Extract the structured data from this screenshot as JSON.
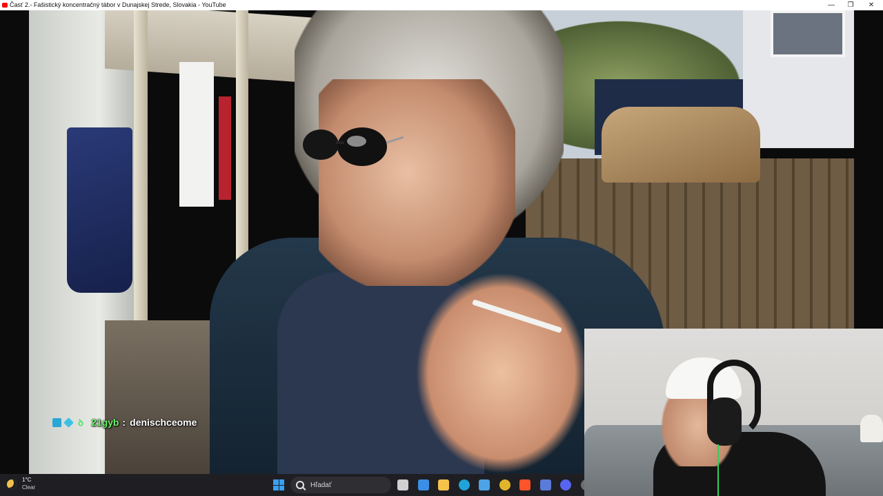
{
  "window": {
    "title": "Časť 2.- Fašistický koncentračný tábor v Dunajskej Strede, Slovakia - YouTube",
    "minimize_glyph": "—",
    "maximize_glyph": "❐",
    "close_glyph": "✕"
  },
  "chat_overlay": {
    "username": "21gyb",
    "separator": ":",
    "message": "denischceome",
    "username_color": "#6bf26a",
    "badges": [
      "moderator-badge",
      "gem-badge",
      "partner-badge"
    ],
    "badge3_glyph": "ꝺ"
  },
  "taskbar": {
    "weather_temp": "1°C",
    "weather_condition": "Clear",
    "search_placeholder": "Hľadať",
    "pinned_apps": [
      "task-view-icon",
      "microsoft-store-icon",
      "file-explorer-icon",
      "edge-icon",
      "photos-icon",
      "chrome-icon",
      "brave-icon",
      "notepad-icon",
      "discord-icon",
      "obs-icon"
    ],
    "app_colors": [
      "#d0d0d0",
      "#3a8ee6",
      "#f3c34b",
      "#1fa3d9",
      "#4da3e6",
      "#e0b42a",
      "#fb542b",
      "#5b7bd8",
      "#5865f2",
      "#6f6f6f"
    ]
  }
}
